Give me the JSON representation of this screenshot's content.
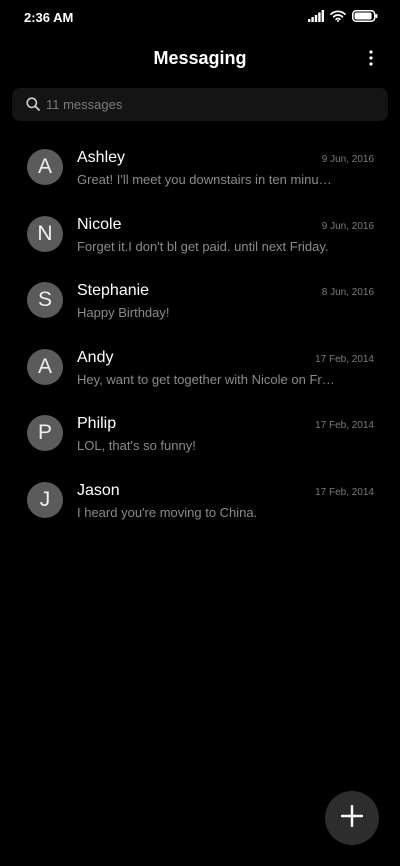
{
  "status_bar": {
    "time": "2:36 AM",
    "icons": [
      "signal-icon",
      "wifi-icon",
      "battery-icon"
    ],
    "battery_level": 0.9
  },
  "header": {
    "title": "Messaging",
    "menu_icon": "more-vertical-icon"
  },
  "search": {
    "placeholder": "11 messages",
    "icon": "search-icon"
  },
  "conversations": [
    {
      "initial": "A",
      "name": "Ashley",
      "date": "9 Jun, 2016",
      "preview": "Great! I'll meet you downstairs in ten minutes."
    },
    {
      "initial": "N",
      "name": "Nicole",
      "date": "9 Jun, 2016",
      "preview": "Forget it.I don't bl get paid. until next Friday."
    },
    {
      "initial": "S",
      "name": "Stephanie",
      "date": "8 Jun, 2016",
      "preview": "Happy Birthday!"
    },
    {
      "initial": "A",
      "name": "Andy",
      "date": "17 Feb, 2014",
      "preview": "Hey, want to get together with Nicole on Friday?"
    },
    {
      "initial": "P",
      "name": "Philip",
      "date": "17 Feb, 2014",
      "preview": "LOL, that's so funny!"
    },
    {
      "initial": "J",
      "name": "Jason",
      "date": "17 Feb, 2014",
      "preview": "I heard you're moving to China."
    }
  ],
  "fab": {
    "icon": "plus-icon"
  },
  "colors": {
    "background": "#000000",
    "search_background": "#141414",
    "avatar": "#5b5b5b",
    "secondary_text": "#8a8a8a",
    "fab_background": "#2d2d2d"
  }
}
